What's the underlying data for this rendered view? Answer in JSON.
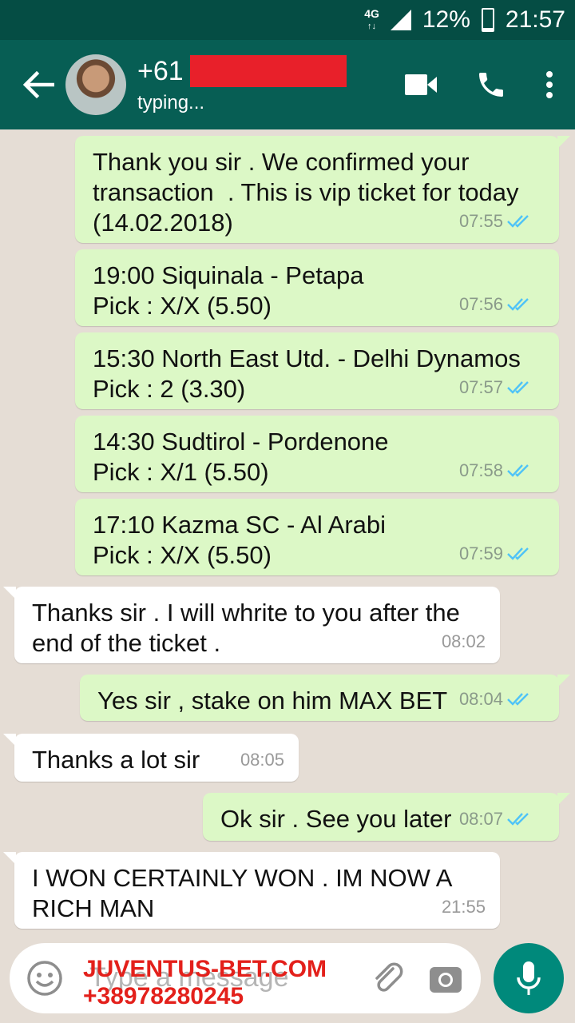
{
  "status_bar": {
    "network": "4G",
    "battery": "12%",
    "time": "21:57"
  },
  "header": {
    "contact_prefix": "+61",
    "status": "typing..."
  },
  "messages": [
    {
      "dir": "out",
      "text": "Thank you sir . We confirmed your transaction  . This is vip ticket for today (14.02.2018)",
      "time": "07:55"
    },
    {
      "dir": "out",
      "text": "19:00 Siquinala - Petapa\nPick : X/X (5.50)",
      "time": "07:56"
    },
    {
      "dir": "out",
      "text": "15:30 North East Utd. - Delhi Dynamos\nPick : 2 (3.30)",
      "time": "07:57"
    },
    {
      "dir": "out",
      "text": "14:30 Sudtirol - Pordenone\nPick : X/1 (5.50)",
      "time": "07:58"
    },
    {
      "dir": "out",
      "text": "17:10 Kazma SC - Al Arabi\nPick : X/X (5.50)",
      "time": "07:59"
    },
    {
      "dir": "in",
      "text": "Thanks sir . I will whrite to you after the end of the ticket .",
      "time": "08:02"
    },
    {
      "dir": "out",
      "text": "Yes sir , stake on him MAX BET",
      "time": "08:04"
    },
    {
      "dir": "in",
      "text": "Thanks a lot sir",
      "time": "08:05"
    },
    {
      "dir": "out",
      "text": "Ok sir . See you later",
      "time": "08:07"
    },
    {
      "dir": "in",
      "text": "I WON CERTAINLY WON . IM NOW A RICH MAN",
      "time": "21:55"
    }
  ],
  "input": {
    "placeholder": "Type a message"
  },
  "watermark": {
    "line1": "JUVENTUS-BET.COM",
    "line2": "+38978280245"
  },
  "colors": {
    "header": "#075e54",
    "outgoing": "#dcf8c6",
    "incoming": "#ffffff",
    "read_ticks": "#4fc3f7",
    "watermark": "#e3201b"
  }
}
